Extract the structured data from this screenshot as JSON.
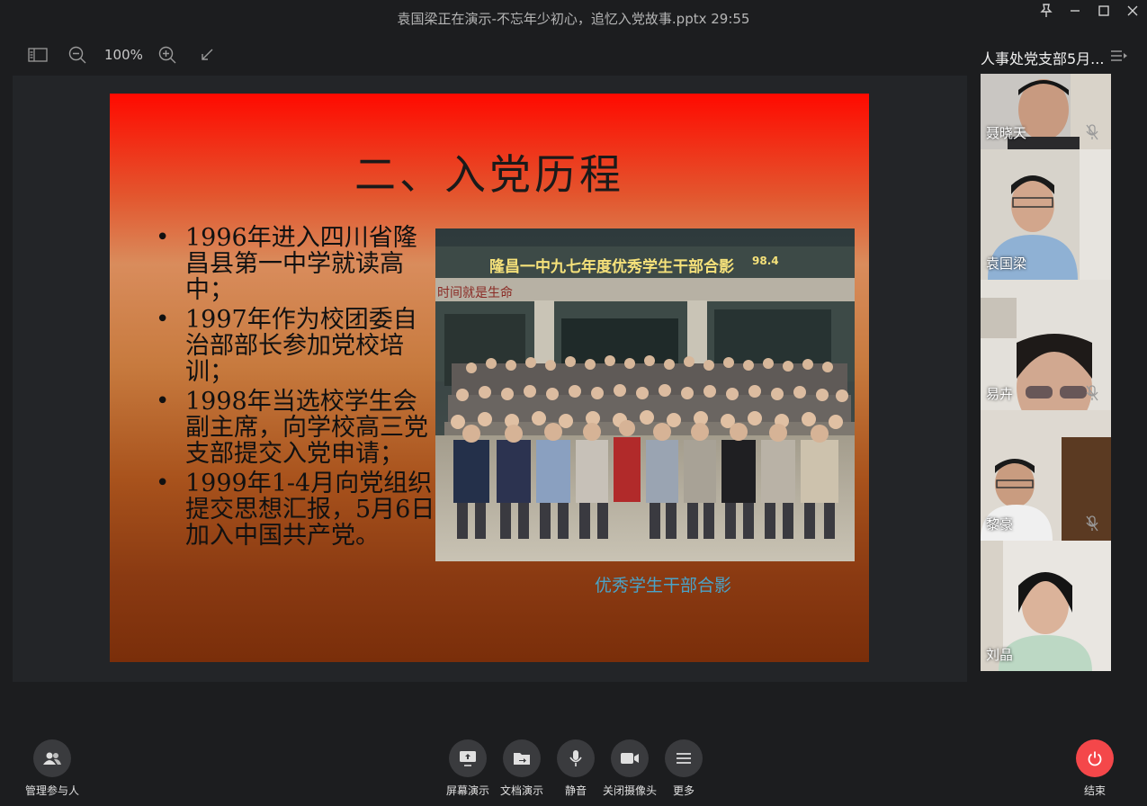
{
  "window": {
    "title": "袁国梁正在演示-不忘年少初心，追忆入党故事.pptx 29:55"
  },
  "toolbar": {
    "zoom": "100%"
  },
  "slide": {
    "title": "二、入党历程",
    "bullets": [
      "1996年进入四川省隆昌县第一中学就读高中；",
      "1997年作为校团委自治部部长参加党校培训；",
      "1998年当选校学生会副主席，向学校高三党支部提交入党申请；",
      "1999年1-4月向党组织提交思想汇报，5月6日加入中国共产党。"
    ],
    "photo_banner": "隆昌一中九七年度优秀学生干部合影",
    "photo_date": "98.4",
    "photo_wall_text": "时间就是生命",
    "caption": "优秀学生干部合影"
  },
  "panel": {
    "meeting_title": "人事处党支部5月...",
    "participants": [
      {
        "name": "聂晓天",
        "muted": true
      },
      {
        "name": "袁国梁",
        "muted": false
      },
      {
        "name": "易卉",
        "muted": true
      },
      {
        "name": "黎豪",
        "muted": true
      },
      {
        "name": "刘晶",
        "muted": false
      }
    ]
  },
  "controls": {
    "manage_participants": "管理参与人",
    "screen_share": "屏幕演示",
    "doc_share": "文档演示",
    "mute": "静音",
    "camera_off": "关闭摄像头",
    "more": "更多",
    "end": "结束"
  },
  "colors": {
    "accent_end": "#f4474a",
    "caption": "#4aa3c8"
  }
}
